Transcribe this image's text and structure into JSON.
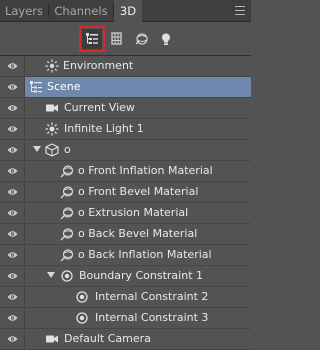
{
  "tabs": [
    {
      "label": "Layers",
      "active": false
    },
    {
      "label": "Channels",
      "active": false
    },
    {
      "label": "3D",
      "active": true
    }
  ],
  "toolbar": {
    "tools": [
      "scene-filter",
      "meshes-filter",
      "materials-filter",
      "lights-filter"
    ],
    "selected": "scene-filter"
  },
  "items": [
    {
      "label": "Environment",
      "icon": "environment-icon",
      "visible": true,
      "selected": false,
      "expanded": null
    },
    {
      "label": "Scene",
      "icon": "scene-icon",
      "visible": true,
      "selected": true,
      "expanded": null
    },
    {
      "label": "Current View",
      "icon": "camera-icon",
      "visible": true,
      "selected": false,
      "expanded": null
    },
    {
      "label": "Infinite Light 1",
      "icon": "light-icon",
      "visible": true,
      "selected": false,
      "expanded": null
    },
    {
      "label": "o",
      "icon": "mesh-icon",
      "visible": true,
      "selected": false,
      "expanded": true
    },
    {
      "label": "o Front Inflation Material",
      "icon": "material-icon",
      "visible": true,
      "selected": false,
      "expanded": null
    },
    {
      "label": "o Front Bevel Material",
      "icon": "material-icon",
      "visible": true,
      "selected": false,
      "expanded": null
    },
    {
      "label": "o Extrusion Material",
      "icon": "material-icon",
      "visible": true,
      "selected": false,
      "expanded": null
    },
    {
      "label": "o Back Bevel Material",
      "icon": "material-icon",
      "visible": true,
      "selected": false,
      "expanded": null
    },
    {
      "label": "o Back Inflation Material",
      "icon": "material-icon",
      "visible": true,
      "selected": false,
      "expanded": null
    },
    {
      "label": "Boundary Constraint 1",
      "icon": "constraint-icon",
      "visible": true,
      "selected": false,
      "expanded": true
    },
    {
      "label": "Internal Constraint 2",
      "icon": "constraint-icon",
      "visible": true,
      "selected": false,
      "expanded": null
    },
    {
      "label": "Internal Constraint 3",
      "icon": "constraint-icon",
      "visible": true,
      "selected": false,
      "expanded": null
    },
    {
      "label": "Default Camera",
      "icon": "camera-icon",
      "visible": true,
      "selected": false,
      "expanded": null
    }
  ],
  "colors": {
    "selection": "#6f86ad",
    "tool_highlight": "#d42a2a",
    "panel_bg": "#535353"
  }
}
